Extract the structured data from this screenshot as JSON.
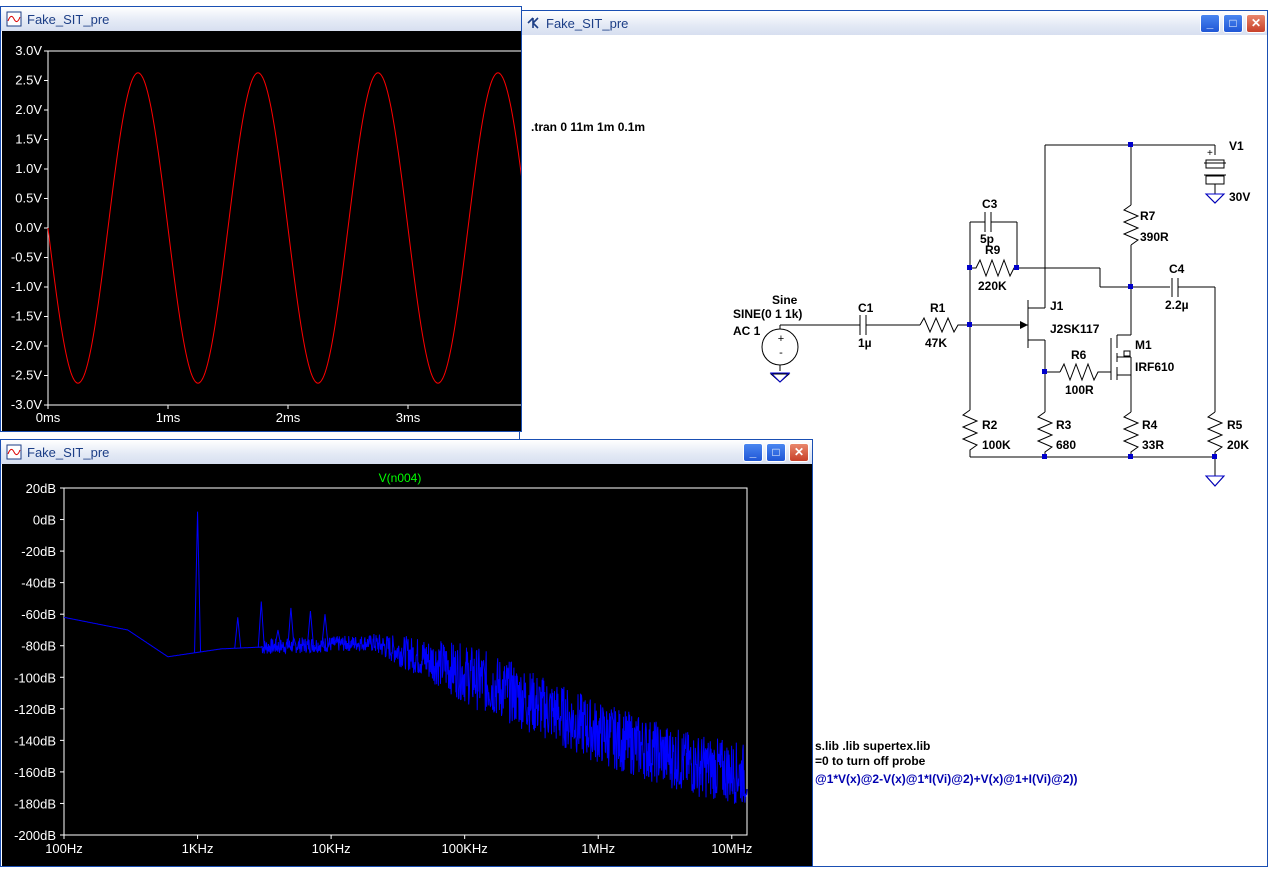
{
  "windows": {
    "time_plot": {
      "title": "Fake_SIT_pre"
    },
    "schematic": {
      "title": "Fake_SIT_pre"
    },
    "fft_plot": {
      "title": "Fake_SIT_pre"
    }
  },
  "window_buttons": {
    "minimize": "_",
    "maximize": "□",
    "close": "✕"
  },
  "schematic": {
    "tran_directive": ".tran 0 11m 1m 0.1m",
    "source": {
      "name": "Sine",
      "value": "SINE(0 1 1k)",
      "ac": "AC 1"
    },
    "components": {
      "C1": {
        "name": "C1",
        "value": "1µ"
      },
      "R1": {
        "name": "R1",
        "value": "47K"
      },
      "C3": {
        "name": "C3",
        "value": "5p"
      },
      "R9": {
        "name": "R9",
        "value": "220K"
      },
      "J1": {
        "name": "J1",
        "value": "J2SK117"
      },
      "R6": {
        "name": "R6",
        "value": "100R"
      },
      "M1": {
        "name": "M1",
        "value": "IRF610"
      },
      "R7": {
        "name": "R7",
        "value": "390R"
      },
      "C4": {
        "name": "C4",
        "value": "2.2µ"
      },
      "V1": {
        "name": "V1",
        "value": "30V"
      },
      "R2": {
        "name": "R2",
        "value": "100K"
      },
      "R3": {
        "name": "R3",
        "value": "680"
      },
      "R4": {
        "name": "R4",
        "value": "33R"
      },
      "R5": {
        "name": "R5",
        "value": "20K"
      }
    },
    "partial_text": [
      "s.lib  .lib supertex.lib",
      "=0 to turn off probe",
      "@1*V(x)@2-V(x)@1*I(Vi)@2)+V(x)@1+I(Vi)@2))"
    ]
  },
  "chart_data": [
    {
      "type": "line",
      "title": "",
      "xlabel": "",
      "ylabel": "",
      "xlim": [
        0,
        4
      ],
      "ylim": [
        -3.0,
        3.0
      ],
      "x_unit": "ms",
      "y_ticks": [
        "3.0V",
        "2.5V",
        "2.0V",
        "1.5V",
        "1.0V",
        "0.5V",
        "0.0V",
        "-0.5V",
        "-1.0V",
        "-1.5V",
        "-2.0V",
        "-2.5V",
        "-3.0V"
      ],
      "x_ticks": [
        "0ms",
        "1ms",
        "2ms",
        "3ms"
      ],
      "series": [
        {
          "color": "#ff0000",
          "waveform": "sine",
          "amplitude": 2.63,
          "frequency_khz": 1,
          "phase": "inverted",
          "x_range_ms": [
            0,
            4
          ]
        }
      ],
      "grid": false
    },
    {
      "type": "line",
      "title": "V(n004)",
      "xlabel": "",
      "ylabel": "",
      "x_scale": "log",
      "xlim": [
        100,
        13000000
      ],
      "ylim": [
        -200,
        20
      ],
      "y_ticks": [
        "20dB",
        "0dB",
        "-20dB",
        "-40dB",
        "-60dB",
        "-80dB",
        "-100dB",
        "-120dB",
        "-140dB",
        "-160dB",
        "-180dB",
        "-200dB"
      ],
      "x_ticks": [
        "100Hz",
        "1KHz",
        "10KHz",
        "100KHz",
        "1MHz",
        "10MHz"
      ],
      "series": [
        {
          "name": "V(n004)",
          "color": "#0000ff",
          "fundamental": {
            "x": 1000,
            "y": 5
          },
          "harmonics": [
            {
              "x": 2000,
              "y": -62
            },
            {
              "x": 3000,
              "y": -52
            },
            {
              "x": 4000,
              "y": -70
            },
            {
              "x": 5000,
              "y": -56
            },
            {
              "x": 7000,
              "y": -58
            },
            {
              "x": 9000,
              "y": -60
            }
          ],
          "noise_floor_points": [
            [
              100,
              -62
            ],
            [
              300,
              -70
            ],
            [
              600,
              -87
            ],
            [
              1500,
              -82
            ],
            [
              5000,
              -80
            ],
            [
              20000,
              -78
            ],
            [
              60000,
              -90
            ],
            [
              200000,
              -108
            ],
            [
              1000000,
              -135
            ],
            [
              5000000,
              -155
            ],
            [
              13000000,
              -162
            ]
          ]
        }
      ],
      "grid": false
    }
  ]
}
